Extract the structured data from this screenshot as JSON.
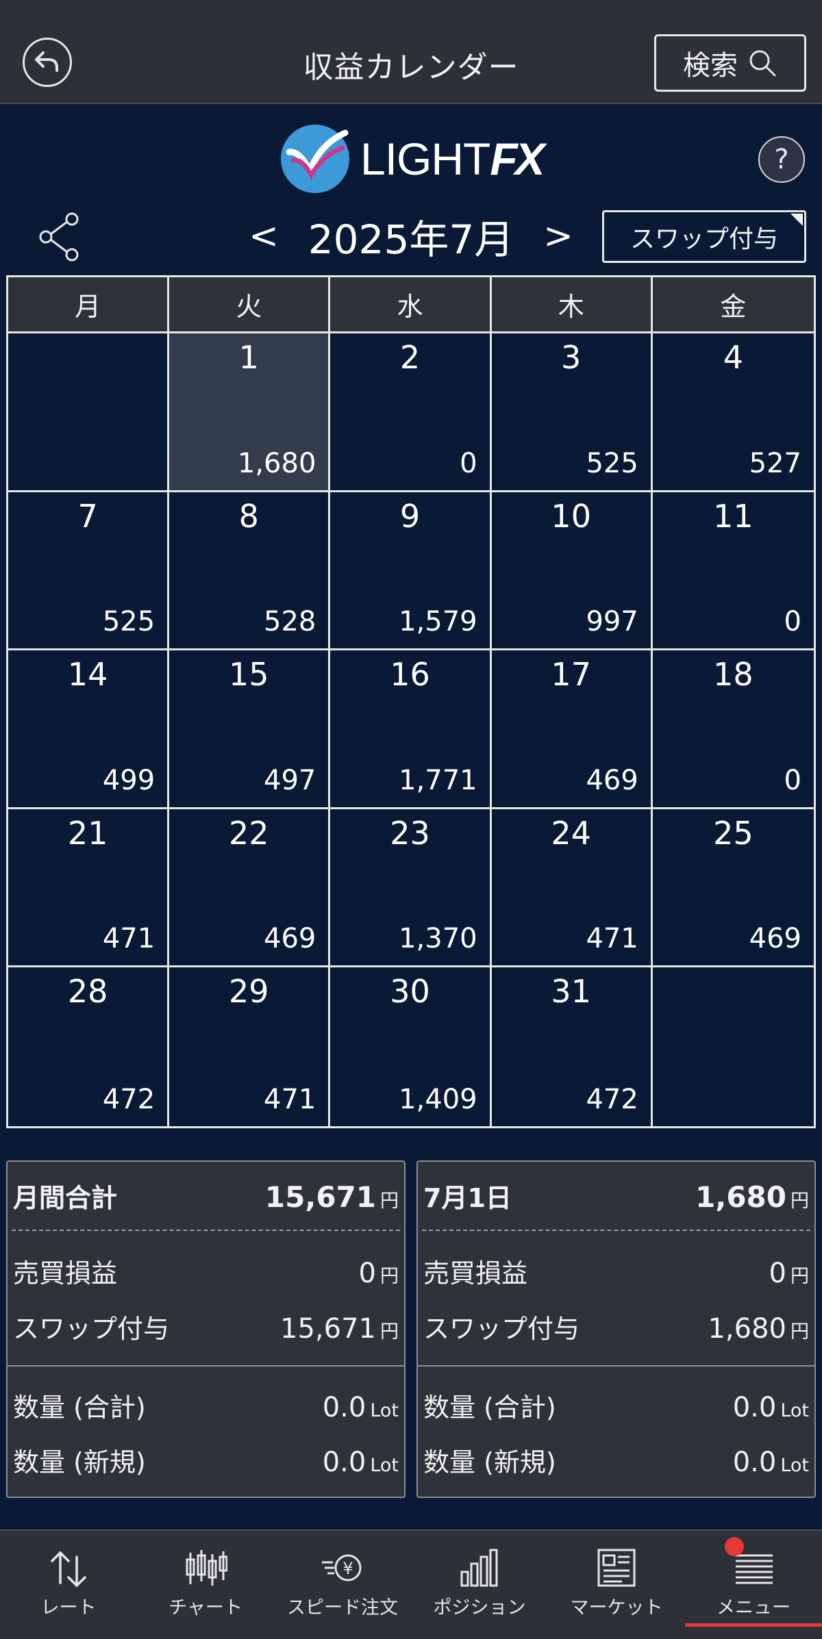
{
  "header": {
    "title": "収益カレンダー",
    "search_label": "検索"
  },
  "logo": {
    "text_light": "LIGHT",
    "text_fx": "FX"
  },
  "help": {
    "label": "?"
  },
  "month_nav": {
    "prev": "<",
    "month": "2025年7月",
    "next": ">"
  },
  "swap_button": {
    "label": "スワップ付与"
  },
  "calendar": {
    "weekdays": [
      "月",
      "火",
      "水",
      "木",
      "金"
    ],
    "cells": [
      {
        "day": "",
        "amount": ""
      },
      {
        "day": "1",
        "amount": "1,680",
        "selected": true
      },
      {
        "day": "2",
        "amount": "0"
      },
      {
        "day": "3",
        "amount": "525"
      },
      {
        "day": "4",
        "amount": "527"
      },
      {
        "day": "7",
        "amount": "525"
      },
      {
        "day": "8",
        "amount": "528"
      },
      {
        "day": "9",
        "amount": "1,579"
      },
      {
        "day": "10",
        "amount": "997"
      },
      {
        "day": "11",
        "amount": "0"
      },
      {
        "day": "14",
        "amount": "499"
      },
      {
        "day": "15",
        "amount": "497"
      },
      {
        "day": "16",
        "amount": "1,771"
      },
      {
        "day": "17",
        "amount": "469"
      },
      {
        "day": "18",
        "amount": "0"
      },
      {
        "day": "21",
        "amount": "471"
      },
      {
        "day": "22",
        "amount": "469"
      },
      {
        "day": "23",
        "amount": "1,370"
      },
      {
        "day": "24",
        "amount": "471"
      },
      {
        "day": "25",
        "amount": "469"
      },
      {
        "day": "28",
        "amount": "472"
      },
      {
        "day": "29",
        "amount": "471"
      },
      {
        "day": "30",
        "amount": "1,409"
      },
      {
        "day": "31",
        "amount": "472"
      },
      {
        "day": "",
        "amount": ""
      }
    ]
  },
  "monthly_summary": {
    "title": "月間合計",
    "total": "15,671",
    "total_unit": "円",
    "trade_pl_label": "売買損益",
    "trade_pl": "0",
    "trade_pl_unit": "円",
    "swap_label": "スワップ付与",
    "swap": "15,671",
    "swap_unit": "円",
    "qty_total_label": "数量 (合計)",
    "qty_total": "0.0",
    "qty_total_unit": "Lot",
    "qty_new_label": "数量 (新規)",
    "qty_new": "0.0",
    "qty_new_unit": "Lot"
  },
  "day_summary": {
    "title": "7月1日",
    "total": "1,680",
    "total_unit": "円",
    "trade_pl_label": "売買損益",
    "trade_pl": "0",
    "trade_pl_unit": "円",
    "swap_label": "スワップ付与",
    "swap": "1,680",
    "swap_unit": "円",
    "qty_total_label": "数量 (合計)",
    "qty_total": "0.0",
    "qty_total_unit": "Lot",
    "qty_new_label": "数量 (新規)",
    "qty_new": "0.0",
    "qty_new_unit": "Lot"
  },
  "bottom_nav": [
    {
      "label": "レート",
      "icon": "rate-arrows-icon"
    },
    {
      "label": "チャート",
      "icon": "candlestick-icon"
    },
    {
      "label": "スピード注文",
      "icon": "speed-order-yen-icon"
    },
    {
      "label": "ポジション",
      "icon": "bar-chart-icon"
    },
    {
      "label": "マーケット",
      "icon": "newspaper-icon"
    },
    {
      "label": "メニュー",
      "icon": "menu-list-icon",
      "active": true
    }
  ],
  "colors": {
    "background": "#0a1a36",
    "header": "#2d3036",
    "selected_cell": "#323d4c",
    "accent_red": "#e53935"
  }
}
